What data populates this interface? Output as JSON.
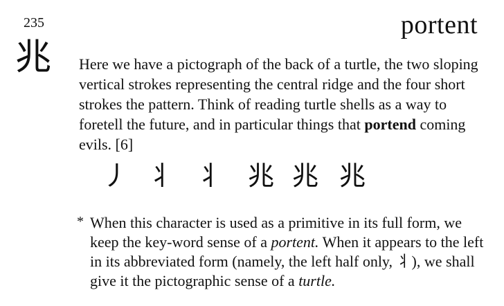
{
  "frame_number": "235",
  "keyword": "portent",
  "kanji": "兆",
  "body": {
    "part1": "Here we have a pictograph of the back of a turtle, the two sloping vertical strokes representing the central ridge and the four short strokes the pattern. Think of reading turtle shells as a way to foretell the future, and in particular things that ",
    "bold": "portend",
    "part2": " coming evils. [6]"
  },
  "stroke_order": [
    "丿",
    "丬",
    "丬",
    "兆",
    "兆",
    "兆"
  ],
  "note": {
    "marker": "*",
    "text1": "When this character is used as a primitive in its full form, we keep the key-word sense of a ",
    "em1": "portent.",
    "text2": " When it appears to the left in its abbreviated form (namely, the left half only, ",
    "glyph": "丬",
    "text3": "), we shall give it the pictographic sense of a ",
    "em2": "turtle."
  }
}
